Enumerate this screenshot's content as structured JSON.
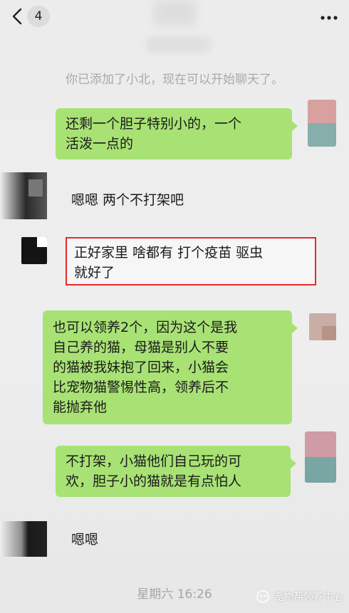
{
  "header": {
    "unread_count": "4"
  },
  "system_message": "你已添加了小北，现在可以开始聊天了。",
  "messages": [
    {
      "text": "还剩一个胆子特别小的，一个\n活泼一点的"
    },
    {
      "text": "嗯嗯 两个不打架吧"
    },
    {
      "text": "正好家里 啥都有 打个疫苗 驱虫\n就好了"
    },
    {
      "text": "也可以领养2个，因为这个是我\n自己养的猫，母猫是别人不要\n的猫被我妹抱了回来，小猫会\n比宠物猫警惕性高，领养后不\n能抛弃他"
    },
    {
      "text": "不打架，小猫他们自己玩的可\n欢，胆子小的猫就是有点怕人"
    },
    {
      "text": "嗯嗯"
    }
  ],
  "timestamp": "星期六 16:26",
  "watermark": "宠物帮领养中心",
  "icons": {
    "back": "chevron-left-icon",
    "more": "more-dots-icon",
    "watermark": "wechat-official-account-icon"
  },
  "colors": {
    "bubble_self": "#a8e275",
    "highlight_border": "#e62a2a"
  }
}
